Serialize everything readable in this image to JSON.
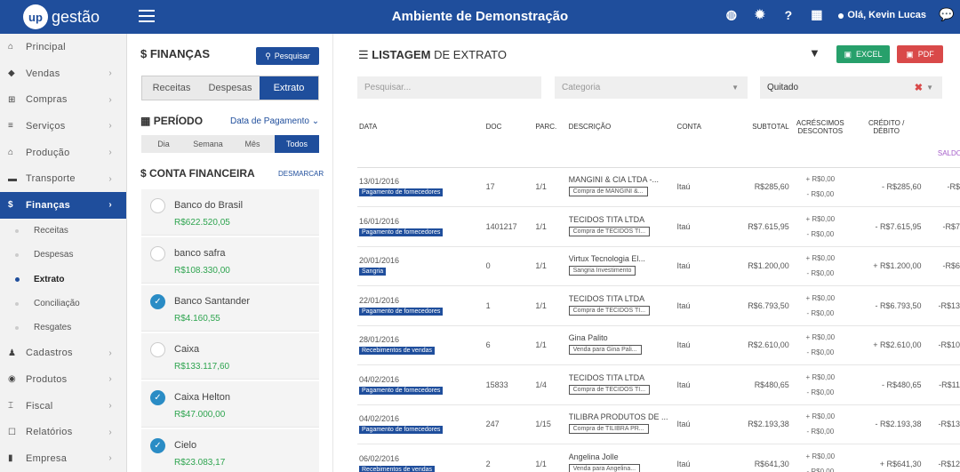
{
  "header": {
    "logo_mark": "up",
    "logo_text": "gestão",
    "title": "Ambiente de Demonstração",
    "user_greeting": "Olá, Kevin Lucas",
    "icons": [
      "globe-icon",
      "gear-icon",
      "help-icon",
      "calendar-icon",
      "user-icon",
      "chat-icon"
    ]
  },
  "sidebar": {
    "items": [
      {
        "label": "Principal",
        "icon": "home-icon"
      },
      {
        "label": "Vendas",
        "icon": "tag-icon"
      },
      {
        "label": "Compras",
        "icon": "cart-icon"
      },
      {
        "label": "Serviços",
        "icon": "services-icon"
      },
      {
        "label": "Produção",
        "icon": "factory-icon"
      },
      {
        "label": "Transporte",
        "icon": "truck-icon"
      },
      {
        "label": "Finanças",
        "icon": "dollar-icon"
      }
    ],
    "sub_items": [
      "Receitas",
      "Despesas",
      "Extrato",
      "Conciliação",
      "Resgates"
    ],
    "items_after": [
      {
        "label": "Cadastros",
        "icon": "person-icon"
      },
      {
        "label": "Produtos",
        "icon": "box-icon"
      },
      {
        "label": "Fiscal",
        "icon": "bank-icon"
      },
      {
        "label": "Relatórios",
        "icon": "report-icon"
      },
      {
        "label": "Empresa",
        "icon": "chart-icon"
      }
    ]
  },
  "finance": {
    "title": "FINANÇAS",
    "search_button": "Pesquisar",
    "tabs": [
      "Receitas",
      "Despesas",
      "Extrato"
    ],
    "periodo_title": "PERÍODO",
    "periodo_select": "Data de Pagamento",
    "period_tabs": [
      "Dia",
      "Semana",
      "Mês",
      "Todos"
    ],
    "conta_title": "CONTA FINANCEIRA",
    "desmarcar": "DESMARCAR",
    "accounts": [
      {
        "name": "Banco do Brasil",
        "balance": "R$622.520,05",
        "checked": false
      },
      {
        "name": "banco safra",
        "balance": "R$108.330,00",
        "checked": false
      },
      {
        "name": "Banco Santander",
        "balance": "R$4.160,55",
        "checked": true
      },
      {
        "name": "Caixa",
        "balance": "R$133.117,60",
        "checked": false
      },
      {
        "name": "Caixa Helton",
        "balance": "R$47.000,00",
        "checked": true
      },
      {
        "name": "Cielo",
        "balance": "R$23.083,17",
        "checked": true
      }
    ]
  },
  "main": {
    "title_bold": "LISTAGEM",
    "title_rest": "DE EXTRATO",
    "excel_button": "EXCEL",
    "pdf_button": "PDF",
    "search_placeholder": "Pesquisar...",
    "category_placeholder": "Categoria",
    "status_value": "Quitado",
    "columns": {
      "data": "DATA",
      "doc": "DOC",
      "parc": "PARC.",
      "descricao": "DESCRIÇÃO",
      "conta": "CONTA",
      "subtotal": "SUBTOTAL",
      "acrescimos_1": "ACRÉSCIMOS",
      "acrescimos_2": "DESCONTOS",
      "credito_1": "CRÉDITO /",
      "credito_2": "DÉBITO"
    },
    "saldo_label": "SALDO",
    "rows": [
      {
        "date": "13/01/2016",
        "badge": "Pagamento de fornecedores",
        "doc": "17",
        "parc": "1/1",
        "desc": "MANGINI & CIA LTDA -...",
        "desc_tag": "Compra de MANGINI &...",
        "conta": "Itaú",
        "subtotal": "R$285,60",
        "acr": "+ R$0,00",
        "des": "- R$0,00",
        "value": "- R$285,60",
        "sign": "neg",
        "saldo": "-R$"
      },
      {
        "date": "16/01/2016",
        "badge": "Pagamento de fornecedores",
        "doc": "1401217",
        "parc": "1/1",
        "desc": "TECIDOS TITA LTDA",
        "desc_tag": "Compra de TECIDOS TI...",
        "conta": "Itaú",
        "subtotal": "R$7.615,95",
        "acr": "+ R$0,00",
        "des": "- R$0,00",
        "value": "- R$7.615,95",
        "sign": "neg",
        "saldo": "-R$7"
      },
      {
        "date": "20/01/2016",
        "badge": "Sangria",
        "doc": "0",
        "parc": "1/1",
        "desc": "Virtux Tecnologia El...",
        "desc_tag": "Sangria Investimento",
        "conta": "Itaú",
        "subtotal": "R$1.200,00",
        "acr": "+ R$0,00",
        "des": "- R$0,00",
        "value": "+ R$1.200,00",
        "sign": "pos",
        "saldo": "-R$6"
      },
      {
        "date": "22/01/2016",
        "badge": "Pagamento de fornecedores",
        "doc": "1",
        "parc": "1/1",
        "desc": "TECIDOS TITA LTDA",
        "desc_tag": "Compra de TECIDOS TI...",
        "conta": "Itaú",
        "subtotal": "R$6.793,50",
        "acr": "+ R$0,00",
        "des": "- R$0,00",
        "value": "- R$6.793,50",
        "sign": "neg",
        "saldo": "-R$13"
      },
      {
        "date": "28/01/2016",
        "badge": "Recebimentos de vendas",
        "doc": "6",
        "parc": "1/1",
        "desc": "Gina Palito",
        "desc_tag": "Venda para Gina Pali...",
        "conta": "Itaú",
        "subtotal": "R$2.610,00",
        "acr": "+ R$0,00",
        "des": "- R$0,00",
        "value": "+ R$2.610,00",
        "sign": "pos",
        "saldo": "-R$10"
      },
      {
        "date": "04/02/2016",
        "badge": "Pagamento de fornecedores",
        "doc": "15833",
        "parc": "1/4",
        "desc": "TECIDOS TITA LTDA",
        "desc_tag": "Compra de TECIDOS TI...",
        "conta": "Itaú",
        "subtotal": "R$480,65",
        "acr": "+ R$0,00",
        "des": "- R$0,00",
        "value": "- R$480,65",
        "sign": "neg",
        "saldo": "-R$11"
      },
      {
        "date": "04/02/2016",
        "badge": "Pagamento de fornecedores",
        "doc": "247",
        "parc": "1/15",
        "desc": "TILIBRA PRODUTOS DE ...",
        "desc_tag": "Compra de TILIBRA PR...",
        "conta": "Itaú",
        "subtotal": "R$2.193,38",
        "acr": "+ R$0,00",
        "des": "- R$0,00",
        "value": "- R$2.193,38",
        "sign": "neg",
        "saldo": "-R$13"
      },
      {
        "date": "06/02/2016",
        "badge": "Recebimentos de vendas",
        "doc": "2",
        "parc": "1/1",
        "desc": "Angelina Jolle",
        "desc_tag": "Venda para Angelina...",
        "conta": "Itaú",
        "subtotal": "R$641,30",
        "acr": "+ R$0,00",
        "des": "- R$0,00",
        "value": "+ R$641,30",
        "sign": "pos",
        "saldo": "-R$12"
      }
    ]
  },
  "colors": {
    "primary": "#1f4e9c",
    "success": "#27a06b",
    "danger": "#d94949",
    "positive": "#2ea44f",
    "saldo": "#a55ec9"
  }
}
